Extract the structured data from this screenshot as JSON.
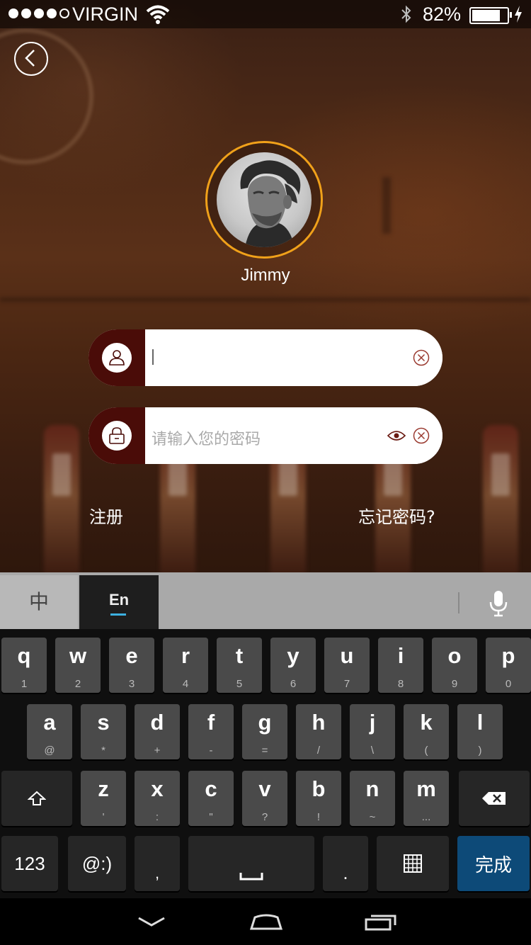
{
  "status_bar": {
    "carrier": "VIRGIN",
    "battery_percent": "82%",
    "battery_level": 0.82
  },
  "profile": {
    "username": "Jimmy"
  },
  "login_form": {
    "username_value": "",
    "password_placeholder": "请输入您的密码"
  },
  "links": {
    "register": "注册",
    "forgot_password": "忘记密码?"
  },
  "keyboard": {
    "lang_tabs": [
      "中",
      "En"
    ],
    "active_tab": "En",
    "row1": [
      {
        "key": "q",
        "sub": "1"
      },
      {
        "key": "w",
        "sub": "2"
      },
      {
        "key": "e",
        "sub": "3"
      },
      {
        "key": "r",
        "sub": "4"
      },
      {
        "key": "t",
        "sub": "5"
      },
      {
        "key": "y",
        "sub": "6"
      },
      {
        "key": "u",
        "sub": "7"
      },
      {
        "key": "i",
        "sub": "8"
      },
      {
        "key": "o",
        "sub": "9"
      },
      {
        "key": "p",
        "sub": "0"
      }
    ],
    "row2": [
      {
        "key": "a",
        "sub": "@"
      },
      {
        "key": "s",
        "sub": "*"
      },
      {
        "key": "d",
        "sub": "+"
      },
      {
        "key": "f",
        "sub": "-"
      },
      {
        "key": "g",
        "sub": "="
      },
      {
        "key": "h",
        "sub": "/"
      },
      {
        "key": "j",
        "sub": "\\"
      },
      {
        "key": "k",
        "sub": "("
      },
      {
        "key": "l",
        "sub": ")"
      }
    ],
    "row3": [
      {
        "key": "z",
        "sub": "'"
      },
      {
        "key": "x",
        "sub": ":"
      },
      {
        "key": "c",
        "sub": "\""
      },
      {
        "key": "v",
        "sub": "?"
      },
      {
        "key": "b",
        "sub": "!"
      },
      {
        "key": "n",
        "sub": "~"
      },
      {
        "key": "m",
        "sub": "..."
      }
    ],
    "row4": {
      "numbers": "123",
      "emoticon": ":)",
      "emoticon_prefix": "@",
      "comma": ",",
      "period": ".",
      "done": "完成"
    }
  },
  "icons": {
    "back": "chevron-left-icon",
    "user": "user-icon",
    "lock": "lock-icon",
    "clear": "clear-circle-icon",
    "eye": "eye-icon",
    "mic": "microphone-icon",
    "shift": "shift-icon",
    "backspace": "backspace-icon",
    "space": "space-bar-icon",
    "keypad": "keyboard-grid-icon"
  },
  "colors": {
    "accent_ring": "#f0a11a",
    "input_cap": "#4a0c08",
    "done_key": "#0d4a78"
  }
}
